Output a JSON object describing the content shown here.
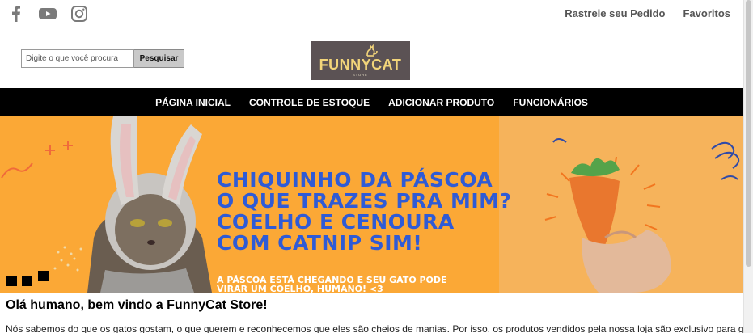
{
  "topbar": {
    "social_icons": [
      "facebook-icon",
      "youtube-icon",
      "instagram-icon"
    ],
    "links": [
      "Rastreie seu Pedido",
      "Favoritos"
    ]
  },
  "search": {
    "placeholder": "Digite o que você procura",
    "button_label": "Pesquisar"
  },
  "logo": {
    "brand": "FUNNYCAT",
    "sub": "STORE"
  },
  "nav": {
    "items": [
      "PÁGINA INICIAL",
      "CONTROLE DE ESTOQUE",
      "ADICIONAR PRODUTO",
      "FUNCIONÁRIOS"
    ]
  },
  "banner": {
    "headline": [
      "CHIQUINHO DA PÁSCOA",
      "O QUE TRAZES PRA MIM?",
      "COELHO E CENOURA",
      "COM CATNIP SIM!"
    ],
    "subline": [
      "A PÁSCOA ESTÁ CHEGANDO E SEU GATO PODE",
      "VIRAR UM COELHO, HUMANO! <3"
    ]
  },
  "content": {
    "welcome_title": "Olá humano, bem vindo a FunnyCat Store!",
    "paragraph": "Nós sabemos do que os gatos gostam, o que querem e reconhecemos que eles são cheios de manias. Por isso, os produtos vendidos pela nossa loja são exclusivo para gatos, pensando"
  },
  "colors": {
    "banner_orange": "#fba836",
    "headline_blue": "#2f5bd6",
    "logo_bg": "#5b5254",
    "nav_bg": "#000000"
  }
}
